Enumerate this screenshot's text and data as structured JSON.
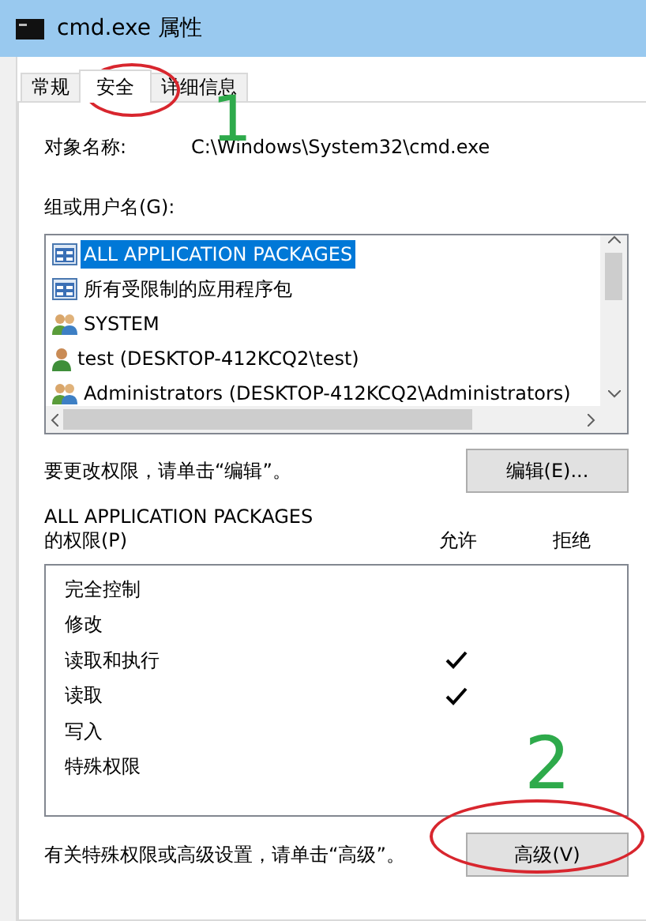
{
  "window": {
    "title": "cmd.exe 属性"
  },
  "tabs": [
    {
      "label": "常规",
      "selected": false
    },
    {
      "label": "安全",
      "selected": true
    },
    {
      "label": "详细信息",
      "selected": false
    }
  ],
  "object_name": {
    "label": "对象名称:",
    "value": "C:\\Windows\\System32\\cmd.exe"
  },
  "groups": {
    "label": "组或用户名(G):",
    "items": [
      {
        "name": "ALL APPLICATION PACKAGES",
        "kind": "package",
        "selected": true
      },
      {
        "name": "所有受限制的应用程序包",
        "kind": "package",
        "selected": false
      },
      {
        "name": "SYSTEM",
        "kind": "group",
        "selected": false
      },
      {
        "name": "test (DESKTOP-412KCQ2\\test)",
        "kind": "user",
        "selected": false
      },
      {
        "name": "Administrators (DESKTOP-412KCQ2\\Administrators)",
        "kind": "group",
        "selected": false
      }
    ]
  },
  "edit_hint": "要更改权限，请单击“编辑”。",
  "edit_button": "编辑(E)...",
  "permissions": {
    "title": "ALL APPLICATION PACKAGES",
    "label": "的权限(P)",
    "columns": [
      "允许",
      "拒绝"
    ],
    "rows": [
      {
        "name": "完全控制",
        "allow": false,
        "deny": false
      },
      {
        "name": "修改",
        "allow": false,
        "deny": false
      },
      {
        "name": "读取和执行",
        "allow": true,
        "deny": false
      },
      {
        "name": "读取",
        "allow": true,
        "deny": false
      },
      {
        "name": "写入",
        "allow": false,
        "deny": false
      },
      {
        "name": "特殊权限",
        "allow": false,
        "deny": false
      }
    ]
  },
  "advanced_hint": "有关特殊权限或高级设置，请单击“高级”。",
  "advanced_button": "高级(V)",
  "annotations": [
    {
      "kind": "ellipse"
    },
    {
      "kind": "number",
      "text": "1"
    },
    {
      "kind": "ellipse"
    },
    {
      "kind": "number",
      "text": "2"
    }
  ]
}
